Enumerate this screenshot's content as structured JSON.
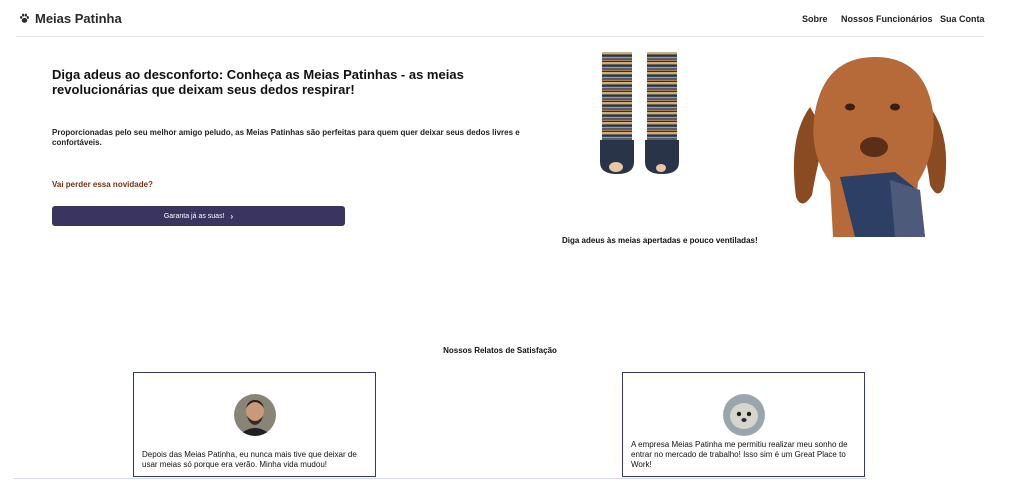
{
  "nav": {
    "brand": "Meias Patinha",
    "brand_icon": "paw-icon",
    "links": [
      "Sobre",
      "Nossos Funcionários",
      "Sua Conta"
    ]
  },
  "hero": {
    "title": "Diga adeus ao desconforto: Conheça as Meias Patinhas - as meias revolucionárias que deixam seus dedos respirar!",
    "subtitle": "Proporcionadas pelo seu melhor amigo peludo, as Meias Patinhas são perfeitas para quem quer deixar seus dedos livres e confortáveis.",
    "cta_question": "Vai perder essa novidade?",
    "cta_button": "Garanta já as suas!",
    "caption": "Diga adeus às meias apertadas e pouco ventiladas!"
  },
  "testimonials": {
    "title": "Nossos Relatos de Satisfação",
    "items": [
      {
        "text": "Depois das Meias Patinha, eu nunca mais tive que deixar de usar meias só porque era verão. Minha vida mudou!"
      },
      {
        "text": "A empresa Meias Patinha me permitiu realizar meu sonho de entrar no mercado de trabalho! Isso sim é um Great Place to Work!"
      }
    ]
  },
  "colors": {
    "button": "#3a3460",
    "accent_text": "#7a2f12",
    "card_border": "#333a6a"
  }
}
